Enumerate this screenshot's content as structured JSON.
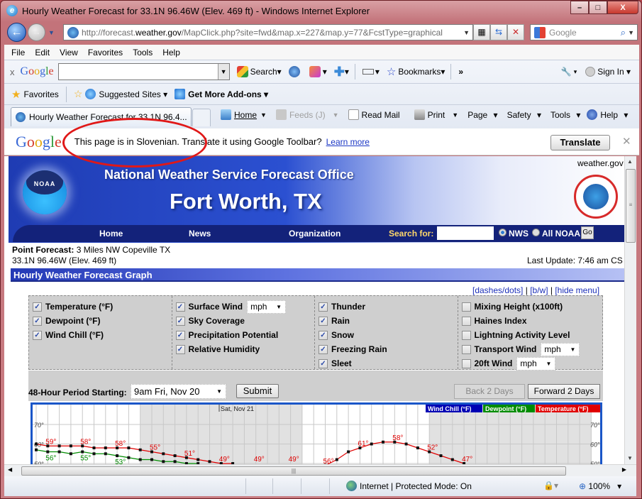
{
  "window": {
    "title": "Hourly Weather Forecast for 33.1N 96.46W (Elev. 469 ft) - Windows Internet Explorer",
    "minimize": "–",
    "maximize": "□",
    "close": "X"
  },
  "addressbar": {
    "url_prefix": "http://forecast.",
    "url_domain": "weather.gov",
    "url_rest": "/MapClick.php?site=fwd&map.x=227&map.y=77&FcstType=graphical",
    "search_placeholder": "Google"
  },
  "menu": [
    "File",
    "Edit",
    "View",
    "Favorites",
    "Tools",
    "Help"
  ],
  "google_toolbar": {
    "close": "x",
    "search_label": "Search",
    "bookmarks_label": "Bookmarks",
    "more": "»",
    "sign_in": "Sign In"
  },
  "favorites_bar": {
    "favorites": "Favorites",
    "suggested_sites": "Suggested Sites",
    "add_ons": "Get More Add-ons"
  },
  "tab": {
    "title": "Hourly Weather Forecast for 33.1N 96.4..."
  },
  "command_bar": {
    "home": "Home",
    "feeds": "Feeds (J)",
    "read_mail": "Read Mail",
    "print": "Print",
    "page": "Page",
    "safety": "Safety",
    "tools": "Tools",
    "help": "Help"
  },
  "translate_bar": {
    "logo": "Google",
    "message": "This page is in Slovenian.  Translate it using Google Toolbar?",
    "learn_more": "Learn more",
    "translate_button": "Translate",
    "close": "✕"
  },
  "banner": {
    "noaa": "NOAA",
    "title": "National Weather Service Forecast Office",
    "city": "Fort Worth, TX",
    "site": "weather.gov",
    "nav": [
      "Home",
      "News",
      "Organization"
    ],
    "search_label": "Search for:",
    "search_value": "",
    "radio_nws": "NWS",
    "radio_all": "All NOAA",
    "go": "Go"
  },
  "forecast": {
    "point_label": "Point Forecast:",
    "point_value": "3 Miles NW Copeville TX",
    "coords": "33.1N 96.46W (Elev. 469 ft)",
    "last_update": "Last Update: 7:46 am CS",
    "section_title": "Hourly Weather Forecast Graph",
    "links": [
      "[dashes/dots]",
      "[b/w]",
      "[hide menu]"
    ],
    "link_sep": " | "
  },
  "options": {
    "col1": [
      {
        "label": "Temperature (°F)",
        "checked": true
      },
      {
        "label": "Dewpoint (°F)",
        "checked": true
      },
      {
        "label": "Wind Chill (°F)",
        "checked": true
      }
    ],
    "col2": [
      {
        "label": "Surface Wind",
        "checked": true,
        "unit": "mph"
      },
      {
        "label": "Sky Coverage",
        "checked": true
      },
      {
        "label": "Precipitation Potential",
        "checked": true
      },
      {
        "label": "Relative Humidity",
        "checked": true
      }
    ],
    "col3": [
      {
        "label": "Thunder",
        "checked": true
      },
      {
        "label": "Rain",
        "checked": true
      },
      {
        "label": "Snow",
        "checked": true
      },
      {
        "label": "Freezing Rain",
        "checked": true
      },
      {
        "label": "Sleet",
        "checked": true
      }
    ],
    "col4": [
      {
        "label": "Mixing Height (x100ft)",
        "checked": false
      },
      {
        "label": "Haines Index",
        "checked": false
      },
      {
        "label": "Lightning Activity Level",
        "checked": false
      },
      {
        "label": "Transport Wind",
        "checked": false,
        "unit": "mph"
      },
      {
        "label": "20ft Wind",
        "checked": false,
        "unit": "mph"
      }
    ],
    "period_label": "48-Hour Period Starting:",
    "period_value": "9am Fri, Nov 20",
    "submit": "Submit",
    "back": "Back 2 Days",
    "forward": "Forward 2 Days"
  },
  "chart_data": {
    "type": "line",
    "day_label": "Sat, Nov 21",
    "legend": [
      {
        "name": "Wind Chill (°F)",
        "color": "#0000b4"
      },
      {
        "name": "Dewpoint (°F)",
        "color": "#008c00"
      },
      {
        "name": "Temperature (°F)",
        "color": "#e00000"
      }
    ],
    "y_ticks": [
      "70°",
      "60°",
      "50°"
    ],
    "ylim": [
      50,
      75
    ],
    "series": [
      {
        "name": "Temperature (°F)",
        "color": "#e00000",
        "values": [
          60,
          59,
          59,
          59,
          59,
          58,
          58,
          58,
          58,
          57,
          56,
          55,
          54,
          53,
          52,
          51,
          50,
          50,
          null,
          null,
          null,
          null,
          null,
          null,
          null,
          49,
          52,
          56,
          58,
          60,
          61,
          61,
          60,
          58,
          56,
          54,
          52,
          50
        ]
      },
      {
        "name": "Dewpoint (°F)",
        "color": "#008c00",
        "values": [
          57,
          56,
          56,
          55,
          56,
          55,
          55,
          54,
          53,
          52,
          52,
          51,
          51,
          50,
          50
        ]
      }
    ],
    "data_labels": [
      {
        "i": 1,
        "text": "59°",
        "series": 0
      },
      {
        "i": 4,
        "text": "58°",
        "series": 0
      },
      {
        "i": 7,
        "text": "58°",
        "series": 0
      },
      {
        "i": 10,
        "text": "55°",
        "series": 0
      },
      {
        "i": 13,
        "text": "51°",
        "series": 0
      },
      {
        "i": 16,
        "text": "49°",
        "series": 0
      },
      {
        "i": 19,
        "text": "49°",
        "series": 0
      },
      {
        "i": 22,
        "text": "49°",
        "series": 0
      },
      {
        "i": 25,
        "text": "56°",
        "series": 0
      },
      {
        "i": 28,
        "text": "61°",
        "series": 0
      },
      {
        "i": 31,
        "text": "58°",
        "series": 0
      },
      {
        "i": 34,
        "text": "52°",
        "series": 0
      },
      {
        "i": 37,
        "text": "47°",
        "series": 0
      },
      {
        "i": 1,
        "text": "56°",
        "series": 1
      },
      {
        "i": 4,
        "text": "55°",
        "series": 1
      },
      {
        "i": 7,
        "text": "53°",
        "series": 1
      }
    ],
    "night_shading": [
      [
        9,
        23
      ],
      [
        34,
        48
      ]
    ]
  },
  "status": {
    "zone": "Internet | Protected Mode: On",
    "zoom": "100%"
  }
}
